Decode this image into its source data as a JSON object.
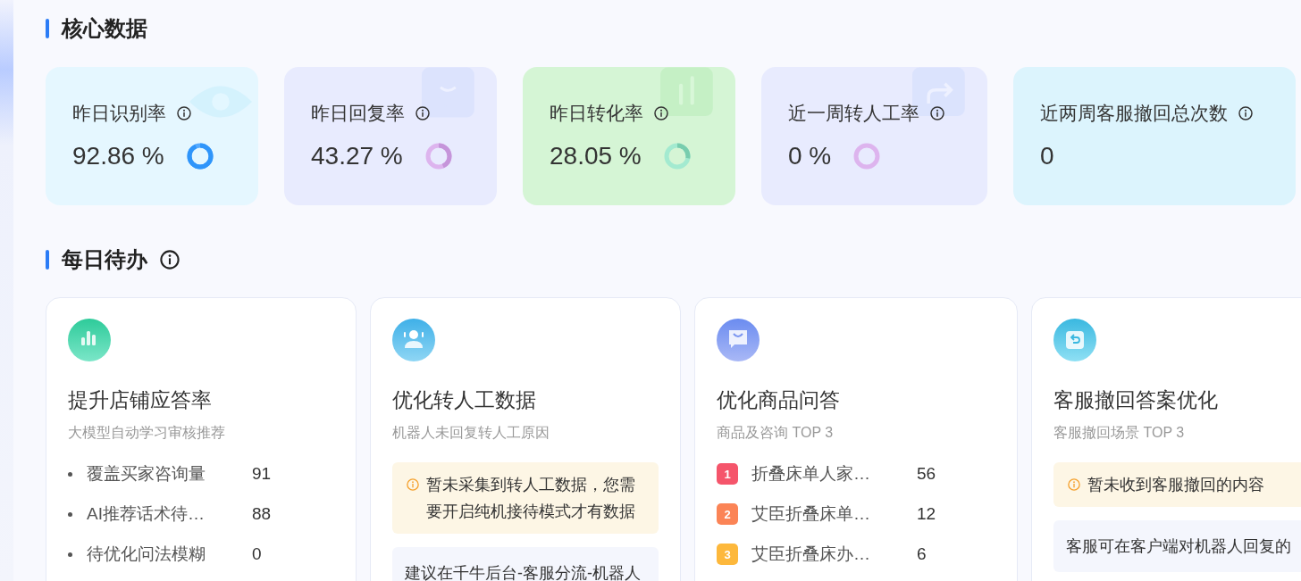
{
  "sections": [
    {
      "title": "核心数据",
      "info": false
    },
    {
      "title": "每日待办",
      "info": true
    }
  ],
  "metrics": [
    {
      "kind": "rate",
      "label": "昨日识别率",
      "value": "92.86 %",
      "level": 0.9286,
      "color": "#55aaff"
    },
    {
      "kind": "rate",
      "label": "昨日回复率",
      "value": "43.27 %",
      "level": 0.4327,
      "color": "#ddb4ee"
    },
    {
      "kind": "rate",
      "label": "昨日转化率",
      "value": "28.05 %",
      "level": 0.2805,
      "color": "#a3ead0"
    },
    {
      "kind": "rate",
      "label": "近一周转人工率",
      "value": "0 %",
      "level": 0,
      "color": "#ddb4ee"
    },
    {
      "kind": "count",
      "label": "近两周客服撤回总次数",
      "value": "0"
    }
  ],
  "tasks": [
    {
      "title": "提升店铺应答率",
      "subtitle": "大模型自动学习审核推荐",
      "rows": [
        {
          "kind": "bullet",
          "label": "覆盖买家咨询量",
          "count": "91"
        },
        {
          "kind": "bullet",
          "label": "AI推荐话术待…",
          "count": "88"
        },
        {
          "kind": "bullet",
          "label": "待优化问法模糊",
          "count": "0"
        }
      ]
    },
    {
      "title": "优化转人工数据",
      "subtitle": "机器人未回复转人工原因",
      "notes": [
        {
          "kind": "warning",
          "text": "暂未采集到转人工数据，您需要开启纯机接待模式才有数据"
        },
        {
          "kind": "tip",
          "text": "建议在千牛后台-客服分流-机器人"
        }
      ]
    },
    {
      "title": "优化商品问答",
      "subtitle": "商品及咨询 TOP 3",
      "rows": [
        {
          "kind": "rank",
          "rank": "1",
          "color": "#f5556b",
          "label": "折叠床单人家…",
          "count": "56"
        },
        {
          "kind": "rank",
          "rank": "2",
          "color": "#fb8456",
          "label": "艾臣折叠床单…",
          "count": "12"
        },
        {
          "kind": "rank",
          "rank": "3",
          "color": "#fdb83c",
          "label": "艾臣折叠床办…",
          "count": "6"
        }
      ]
    },
    {
      "title": "客服撤回答案优化",
      "subtitle": "客服撤回场景 TOP 3",
      "notes": [
        {
          "kind": "warning",
          "text": "暂未收到客服撤回的内容"
        },
        {
          "kind": "tip",
          "text": "客服可在客户端对机器人回复的"
        }
      ]
    }
  ]
}
